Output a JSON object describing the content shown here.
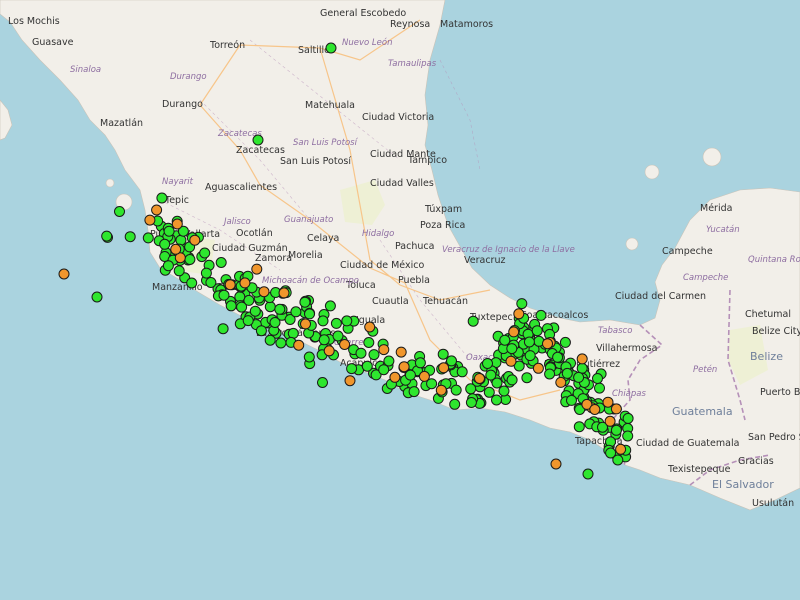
{
  "colors": {
    "sea": "#aad3df",
    "land": "#f2efe9",
    "land_alt": "#eef0d5",
    "border": "#b590b8",
    "road": "#f7c58a",
    "city_text": "#333333",
    "state_text": "#8e6ea1",
    "country_text": "#6e7f9a",
    "marker_green": "#2ee62e",
    "marker_orange": "#f0962c",
    "marker_stroke": "#1a1a1a"
  },
  "labels": {
    "cities": [
      "Los Mochis",
      "Guasave",
      "Torreón",
      "Saltillo",
      "General Escobedo",
      "Reynosa",
      "Matamoros",
      "Durango",
      "Mazatlán",
      "Matehuala",
      "Ciudad Victoria",
      "Zacatecas",
      "San Luis Potosí",
      "Ciudad Mante",
      "Tampico",
      "Aguascalientes",
      "Ciudad Valles",
      "Tepic",
      "Túxpam",
      "Ocotlán",
      "Poza Rica",
      "Puerto Vallarta",
      "Ciudad Guzmán",
      "Celaya",
      "Pachuca",
      "Morelia",
      "Zamora",
      "Ciudad de México",
      "Veracruz",
      "Manzanillo",
      "Colima",
      "Toluca",
      "Puebla",
      "Cuautla",
      "Tehuacán",
      "Coatzacoalcos",
      "Tuxtepec",
      "Lázaro Cárdenas",
      "Iguala",
      "Acapulco",
      "Mérida",
      "Campeche",
      "Ciudad del Carmen",
      "Chetumal",
      "Belize City",
      "Villahermosa",
      "Tuxtla Gutiérrez",
      "Tapachula",
      "Ciudad de Guatemala",
      "Puerto Barrios",
      "San Pedro Sula",
      "Texistepeque",
      "Gracias",
      "Usulután",
      "Ciudad Guzmán"
    ],
    "states": [
      "Sinaloa",
      "Durango",
      "Nuevo León",
      "Tamaulipas",
      "Zacatecas",
      "San Luis Potosí",
      "Nayarit",
      "Jalisco",
      "Guanajuato",
      "Hidalgo",
      "Michoacán de Ocampo",
      "Veracruz de Ignacio de la Llave",
      "Guerrero",
      "Oaxaca",
      "Tabasco",
      "Chiapas",
      "Yucatán",
      "Campeche",
      "Quintana Roo",
      "Petén"
    ],
    "countries": [
      "Guatemala",
      "Belize",
      "El Salvador"
    ]
  },
  "markers": {
    "total_green": 350,
    "total_orange": 40
  }
}
